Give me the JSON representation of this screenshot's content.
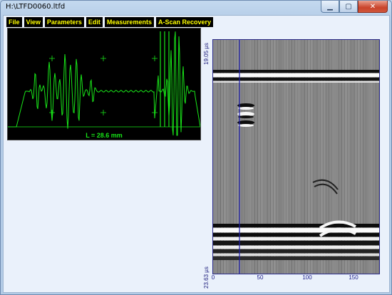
{
  "window": {
    "title": "H:\\LTFD0060.ltfd",
    "min_label": "▁",
    "max_label": "▢",
    "close_label": "✕"
  },
  "menu": {
    "file": "File",
    "view": "View",
    "parameters": "Parameters",
    "edit": "Edit",
    "measurements": "Measurements",
    "ascan_recovery": "A-Scan Recovery"
  },
  "ascan": {
    "readout": "L = 28.6 mm",
    "trace_color": "#19e619",
    "background": "#000000"
  },
  "bscan": {
    "y_top_label": "19.05 µs",
    "y_bottom_label": "23.63 µs",
    "x_ticks": [
      "0",
      "50",
      "100",
      "150"
    ],
    "cursor_color": "#1c1caa",
    "axis_color": "#1a1a7a"
  }
}
